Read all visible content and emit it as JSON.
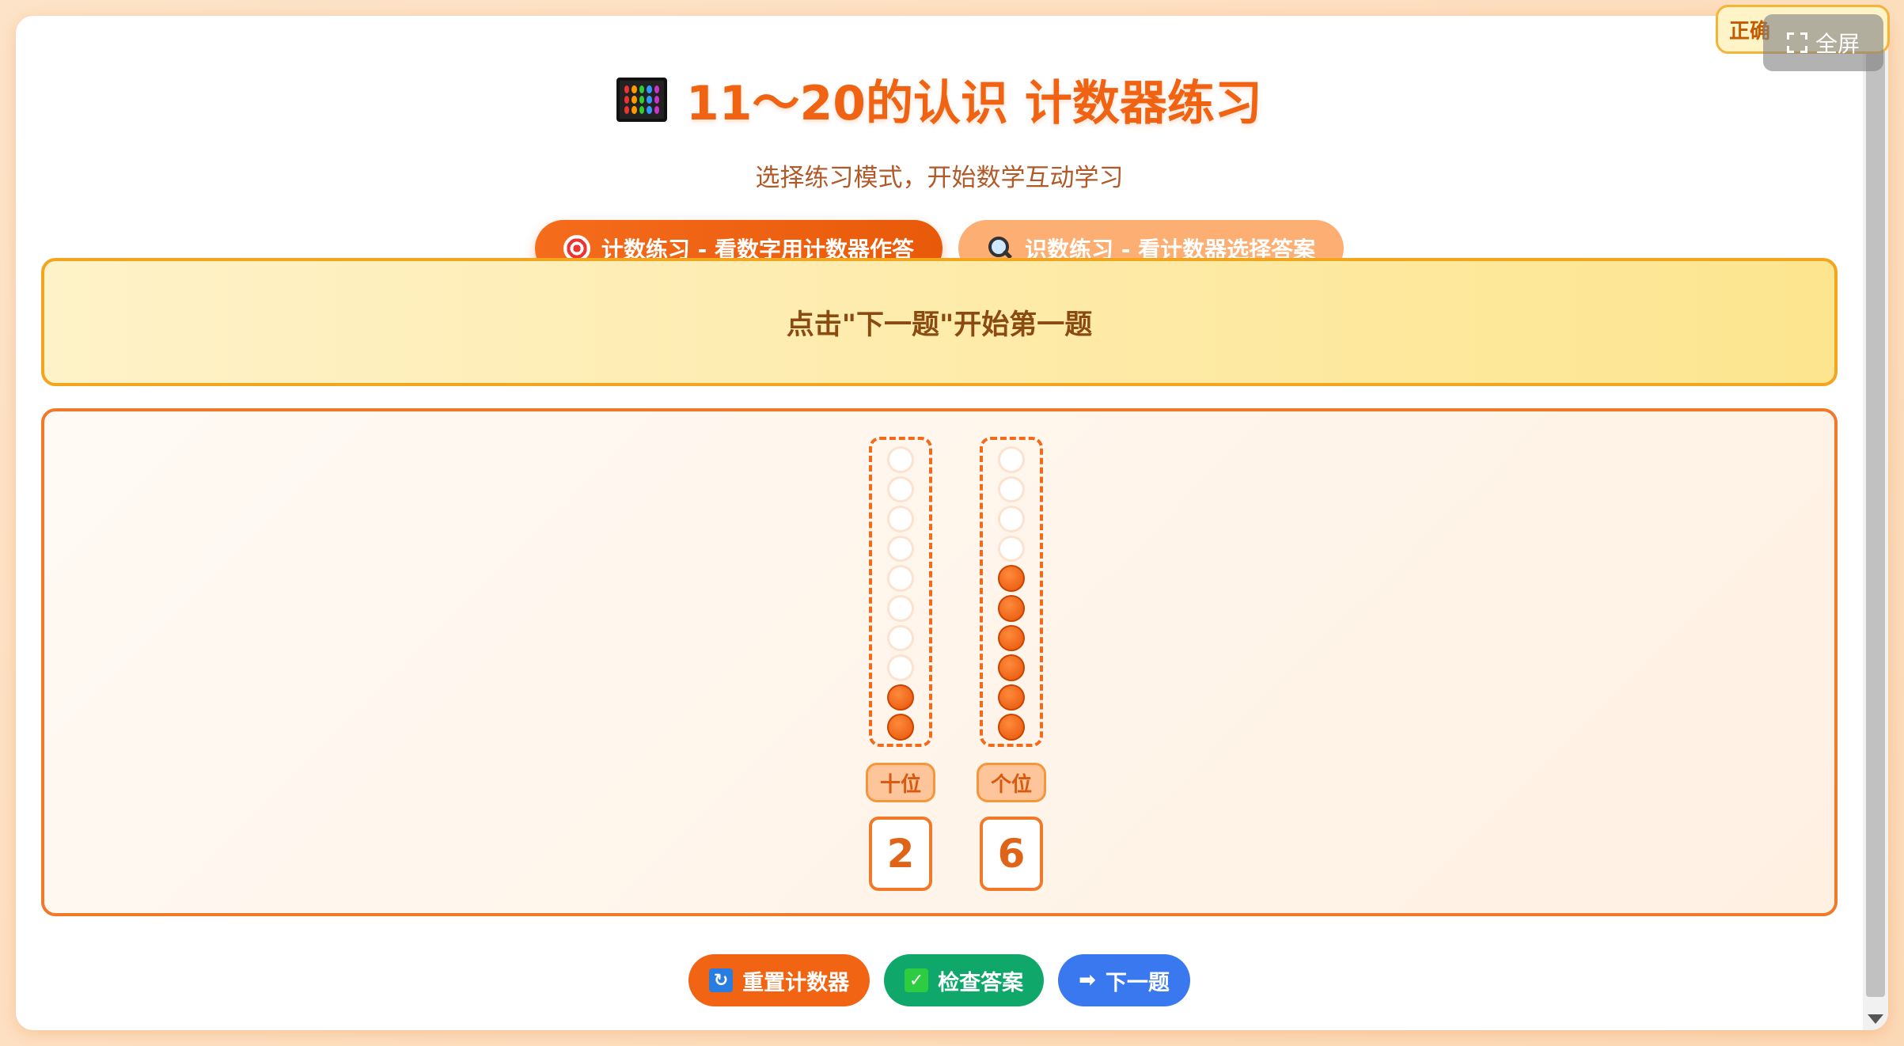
{
  "header": {
    "title": "11～20的认识 计数器练习",
    "subtitle": "选择练习模式，开始数学互动学习"
  },
  "modes": [
    {
      "label": "计数练习 - 看数字用计数器作答",
      "icon": "target-icon",
      "active": true
    },
    {
      "label": "识数练习 - 看计数器选择答案",
      "icon": "magnifier-icon",
      "active": false
    }
  ],
  "prompt": {
    "text": "点击\"下一题\"开始第一题"
  },
  "counter": {
    "bead_slots": 10,
    "rods": [
      {
        "label": "十位",
        "value": "2",
        "count": 2
      },
      {
        "label": "个位",
        "value": "6",
        "count": 6
      }
    ]
  },
  "actions": {
    "reset_label": "重置计数器",
    "check_label": "检查答案",
    "next_label": "下一题"
  },
  "corner": {
    "correct_badge": "正确",
    "fullscreen_label": "全屏"
  },
  "colors": {
    "accent": "#ef6313",
    "check_green": "#0fa86a",
    "next_blue": "#3a78f0",
    "prompt_border": "#f4a51e"
  }
}
